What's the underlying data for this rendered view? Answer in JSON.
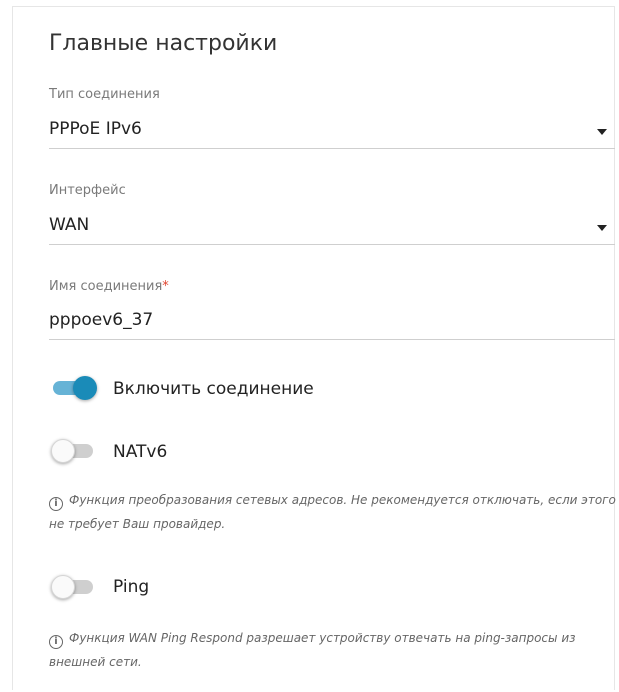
{
  "section": {
    "title": "Главные настройки"
  },
  "connection_type": {
    "label": "Тип соединения",
    "value": "PPPoE IPv6"
  },
  "interface": {
    "label": "Интерфейс",
    "value": "WAN"
  },
  "connection_name": {
    "label": "Имя соединения",
    "required_mark": "*",
    "value": "pppoev6_37"
  },
  "enable_connection": {
    "label": "Включить соединение",
    "state": "on"
  },
  "natv6": {
    "label": "NATv6",
    "state": "off",
    "note": "Функция преобразования сетевых адресов. Не рекомендуется отключать, если этого не требует Ваш провайдер."
  },
  "ping": {
    "label": "Ping",
    "state": "off",
    "note": "Функция WAN Ping Respond разрешает устройству отвечать на ping-запросы из внешней сети."
  },
  "icons": {
    "info": "i",
    "dropdown": "caret-down"
  },
  "colors": {
    "accent": "#1a8bb8",
    "accent_track": "#66b3d6",
    "required": "#e0442f"
  }
}
